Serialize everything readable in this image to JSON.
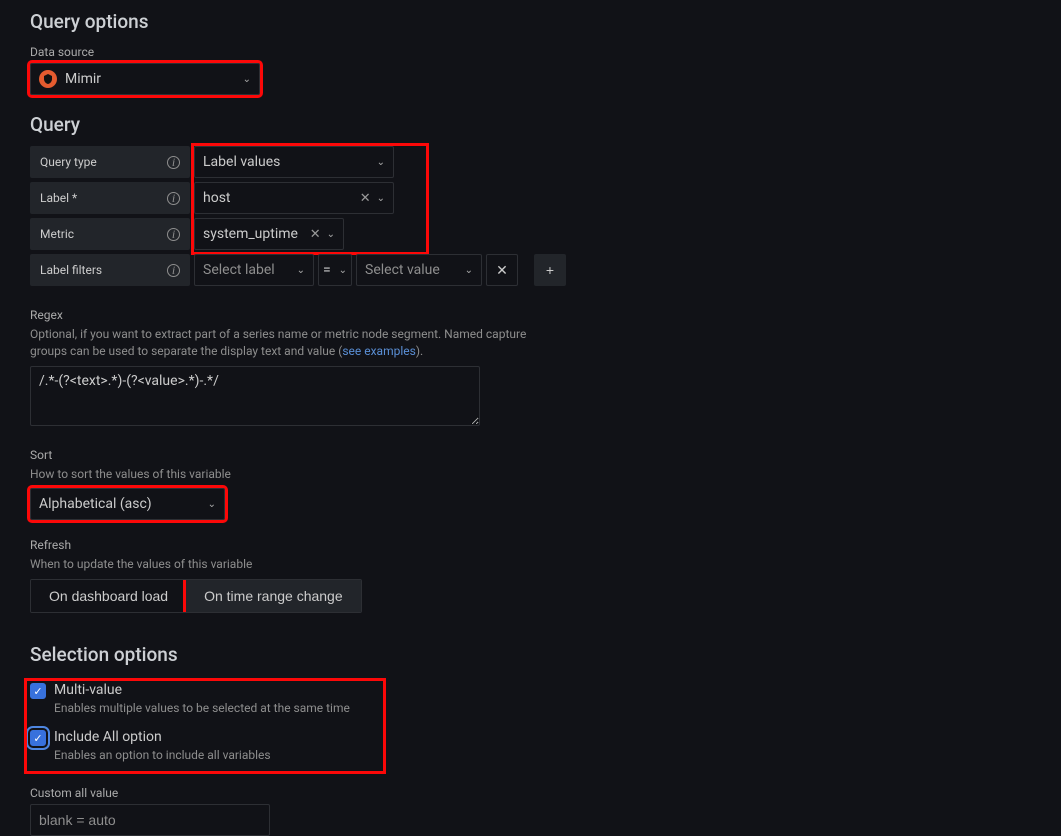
{
  "headings": {
    "query_options": "Query options",
    "query": "Query",
    "selection_options": "Selection options"
  },
  "datasource": {
    "label": "Data source",
    "value": "Mimir"
  },
  "query_type": {
    "label": "Query type",
    "value": "Label values"
  },
  "label_field": {
    "label": "Label *",
    "value": "host"
  },
  "metric_field": {
    "label": "Metric",
    "value": "system_uptime"
  },
  "label_filters": {
    "label": "Label filters",
    "select_label_placeholder": "Select label",
    "operator": "=",
    "select_value_placeholder": "Select value"
  },
  "regex": {
    "label": "Regex",
    "hint_pre": "Optional, if you want to extract part of a series name or metric node segment. Named capture groups can be used to separate the display text and value (",
    "hint_link": "see examples",
    "hint_post": ").",
    "value": "/.*-(?<text>.*)-(?<value>.*)-.*/"
  },
  "sort": {
    "label": "Sort",
    "hint": "How to sort the values of this variable",
    "value": "Alphabetical (asc)"
  },
  "refresh": {
    "label": "Refresh",
    "hint": "When to update the values of this variable",
    "option_dashboard": "On dashboard load",
    "option_timerange": "On time range change"
  },
  "multi_value": {
    "label": "Multi-value",
    "desc": "Enables multiple values to be selected at the same time"
  },
  "include_all": {
    "label": "Include All option",
    "desc": "Enables an option to include all variables"
  },
  "custom_all": {
    "label": "Custom all value",
    "placeholder": "blank = auto"
  },
  "icons": {
    "times": "✕",
    "plus": "+",
    "check": "✓"
  }
}
